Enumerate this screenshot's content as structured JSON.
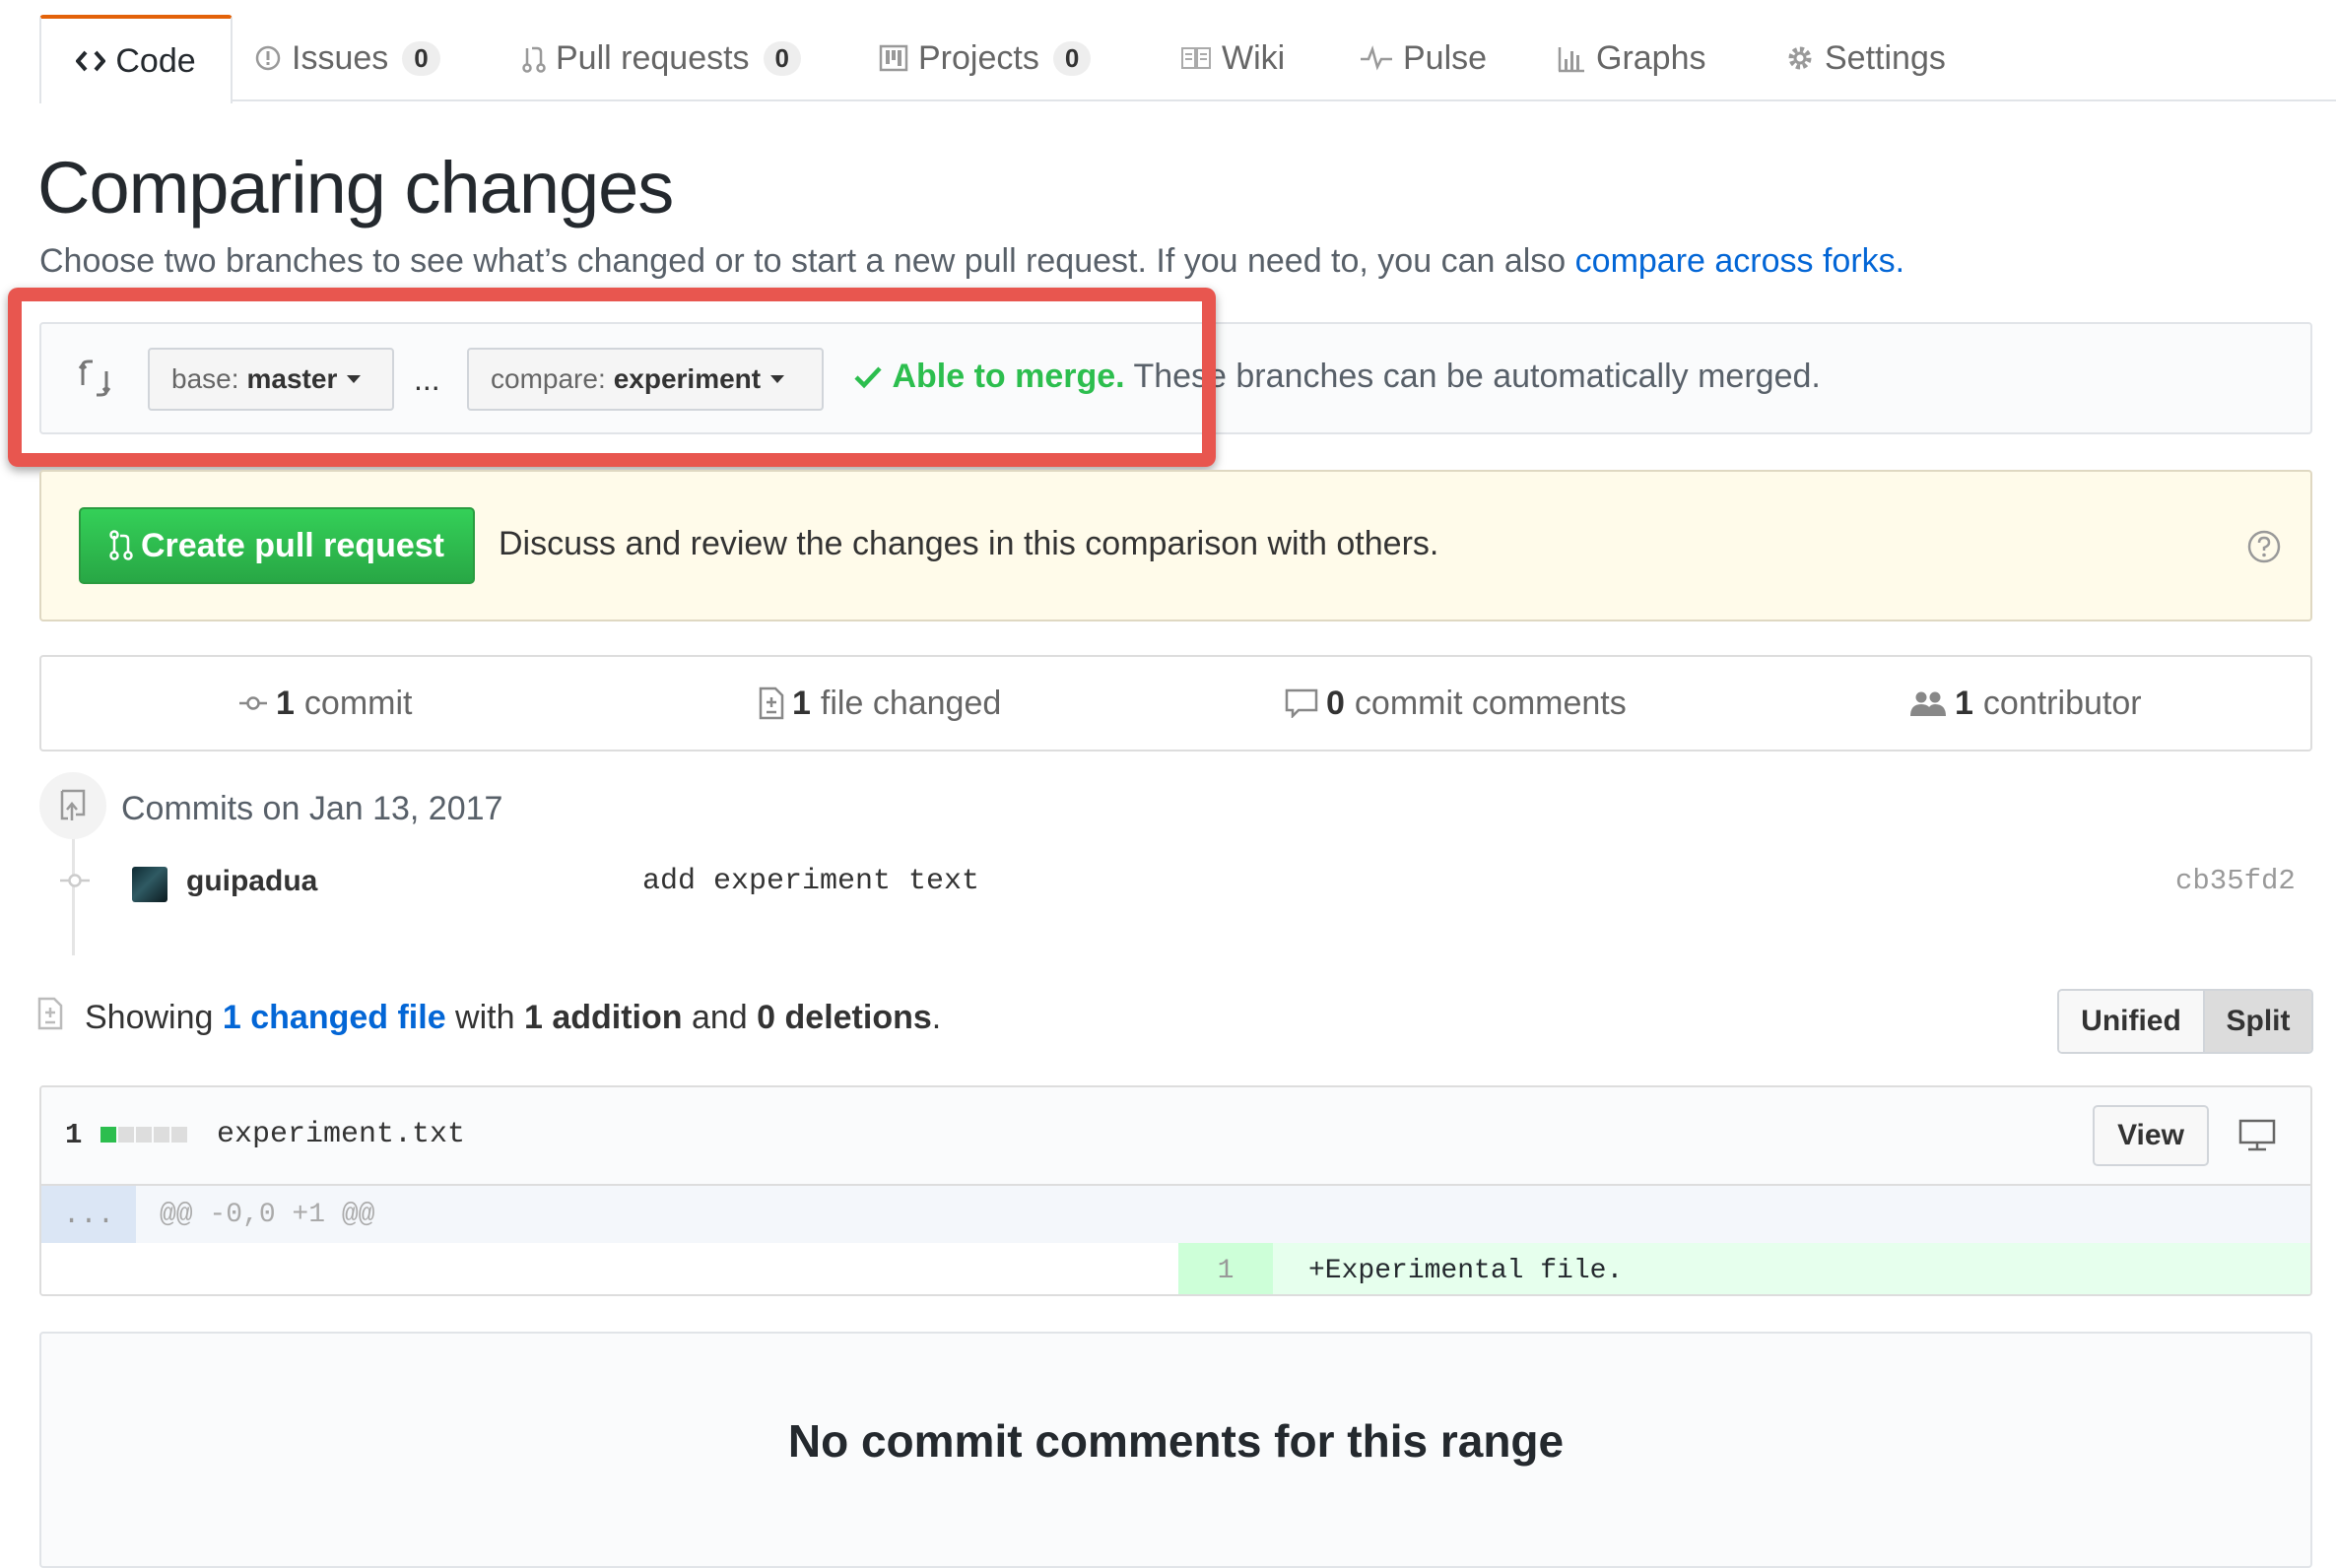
{
  "nav": {
    "tabs": [
      {
        "label": "Code"
      },
      {
        "label": "Issues",
        "count": "0"
      },
      {
        "label": "Pull requests",
        "count": "0"
      },
      {
        "label": "Projects",
        "count": "0"
      },
      {
        "label": "Wiki"
      },
      {
        "label": "Pulse"
      },
      {
        "label": "Graphs"
      },
      {
        "label": "Settings"
      }
    ]
  },
  "header": {
    "title": "Comparing changes",
    "subtitle": "Choose two branches to see what’s changed or to start a new pull request. If you need to, you can also ",
    "subtitle_link": "compare across forks."
  },
  "range": {
    "base_prefix": "base:",
    "base_branch": "master",
    "separator": "...",
    "compare_prefix": "compare:",
    "compare_branch": "experiment",
    "merge_ok": "Able to merge.",
    "merge_text": " These branches can be automatically merged."
  },
  "pr": {
    "button_label": "Create pull request",
    "description": "Discuss and review the changes in this comparison with others."
  },
  "summary": {
    "commits_count": "1",
    "commits_label": "commit",
    "files_count": "1",
    "files_label": "file changed",
    "comments_count": "0",
    "comments_label": "commit comments",
    "contributors_count": "1",
    "contributors_label": "contributor"
  },
  "commits": {
    "date_heading": "Commits on Jan 13, 2017",
    "items": [
      {
        "author": "guipadua",
        "message": "add experiment text",
        "sha": "cb35fd2"
      }
    ]
  },
  "toc": {
    "showing": "Showing ",
    "changed_link": "1 changed file",
    "with": " with ",
    "additions": "1 addition",
    "and": " and ",
    "deletions": "0 deletions",
    "period": "."
  },
  "diff_view": {
    "unified_label": "Unified",
    "split_label": "Split",
    "selected": "Split"
  },
  "file": {
    "changes": "1",
    "name": "experiment.txt",
    "view_label": "View",
    "hunk_expand": "...",
    "hunk_header": "@@ -0,0 +1 @@",
    "added_line_number": "1",
    "added_line": "+Experimental file.",
    "diffstat": {
      "additions": 1,
      "neutral": 4
    }
  },
  "blankslate": {
    "title": "No commit comments for this range"
  },
  "colors": {
    "accent": "#0366d6",
    "success": "#2cbe4e",
    "highlight": "#e8564f",
    "active_tab": "#e36209"
  }
}
